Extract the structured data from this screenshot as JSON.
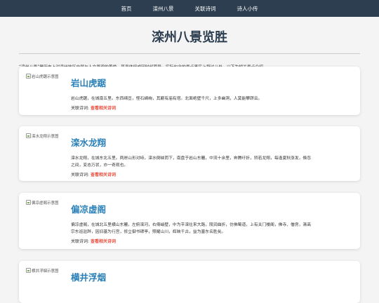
{
  "nav": [
    "首页",
    "滦州八景",
    "关联诗词",
    "诗人小传"
  ],
  "page_title": "滦州八景览胜",
  "intro": "“滦州八景”是历史上对滦州地区自然与人文景观的美誉，其具体组成因时代而异，实际包含的景点事实上超过八处。以下为相关景点介绍。",
  "link_prefix": "关联诗词:",
  "link_text": "查看相关诗词",
  "cards": [
    {
      "alt": "岩山虎踞示意图",
      "title": "岩山虎踞",
      "lines": [
        "岩山虎踞，在城南五里。东西绵亘，怪石嶙峋，其巅有庙有塔。北面绝壁千尺，上多幽洞，人莫能攀跻云。"
      ]
    },
    {
      "alt": "滦水龙翔示意图",
      "title": "滦水龙翔",
      "lines": [
        "滦水龙翔，在城东北五里。两岸山形对峙，滦水倒峡而下，南盘于岩山东麓，中流十余里，奔腾纡折，矫若龙翔，每逢夏秋涨发，倏忽",
        "之间，变态万状，亦一奇观也。"
      ]
    },
    {
      "alt": "偏凉虚阁示意图",
      "title": "偏凉虚阁",
      "lines": [
        "偏凉虚阁，在城北五里横山东麓，左俯滦河，右倚峭壁，中为平滦往来大路，陵润曲折，仿佛蜀道，上有关门楼阁，佛寺、僧房，清高",
        "宗东巡驻跸，因旧基为行宫，修立御书碑亭，照耀山川，辉映千古，益为塞东名胜矣。"
      ]
    },
    {
      "alt": "横井浮烟示意图",
      "title": "横井浮烟",
      "lines": [
        ""
      ]
    }
  ]
}
